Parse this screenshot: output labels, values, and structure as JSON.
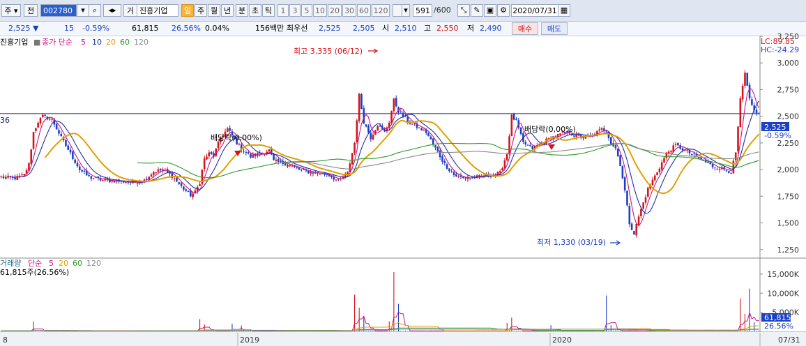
{
  "toolbar": {
    "market_select": "주",
    "prev_label": "전",
    "code": "002780",
    "name_prefix": "거",
    "stock_name": "진흥기업",
    "periods": [
      "일",
      "주",
      "월",
      "년",
      "분",
      "초",
      "틱"
    ],
    "active_period": "일",
    "intervals": [
      "1",
      "3",
      "5",
      "10",
      "20",
      "30",
      "60",
      "120"
    ],
    "count": "591",
    "count_total": "/600",
    "date": "2020/07/31"
  },
  "quote": {
    "price": "2,525",
    "change_arrow": "▼",
    "change": "15",
    "change_pct": "-0.59%",
    "volume": "61,815",
    "volume_ratio": "26.56%",
    "turnover": "0.04%",
    "amount": "156백만",
    "priority_label": "최우선",
    "ask": "2,525",
    "bid": "2,505",
    "open_label": "시",
    "open": "2,510",
    "high_label": "고",
    "high": "2,550",
    "low_label": "저",
    "low": "2,490",
    "buy_label": "매수",
    "sell_label": "매도"
  },
  "colors": {
    "up": "#d6131b",
    "down": "#1a3fc8",
    "ma5": "#c71585",
    "ma10": "#1f2e9e",
    "ma20": "#e0a000",
    "ma60": "#2a9a2a",
    "ma120": "#8a8a8a",
    "price_line": "#1a237e",
    "toolbar_bg": "#dfe6f1"
  },
  "chart_data": [
    {
      "type": "line",
      "title": "진흥기업",
      "legend": {
        "indicator": "종가 단순",
        "periods": [
          "5",
          "10",
          "20",
          "60",
          "120"
        ]
      },
      "partial_label_left": "36",
      "ylim": [
        1170,
        3250
      ],
      "yticks": [
        "3,250",
        "3,000",
        "2,750",
        "2,500",
        "2,250",
        "2,000",
        "1,750",
        "1,500",
        "1,250"
      ],
      "ytick_values": [
        3250,
        3000,
        2750,
        2500,
        2250,
        2000,
        1750,
        1500,
        1250
      ],
      "lc_label": "LC:89.85",
      "hc_label": "HC:-24.29",
      "current_price": 2525,
      "current_price_label": "2,525",
      "current_change_label": "-0.59%",
      "x_labels": [
        "8",
        "2019",
        "2020",
        "07/31"
      ],
      "annotations": {
        "high": "최고 3,335 (06/12)",
        "low": "최저 1,330 (03/19)",
        "div1": "배당락(0,00%)",
        "div2": "배당락(0,00%)"
      },
      "close_path": [
        [
          0,
          1930
        ],
        [
          6,
          1920
        ],
        [
          10,
          1950
        ],
        [
          12,
          2050
        ],
        [
          14,
          2350
        ],
        [
          16,
          2450
        ],
        [
          18,
          2500
        ],
        [
          22,
          2470
        ],
        [
          26,
          2300
        ],
        [
          30,
          2150
        ],
        [
          34,
          2000
        ],
        [
          38,
          1930
        ],
        [
          44,
          1900
        ],
        [
          52,
          1890
        ],
        [
          58,
          1880
        ],
        [
          62,
          1900
        ],
        [
          66,
          1980
        ],
        [
          70,
          2000
        ],
        [
          74,
          1940
        ],
        [
          78,
          1840
        ],
        [
          82,
          1760
        ],
        [
          84,
          1790
        ],
        [
          86,
          1880
        ],
        [
          88,
          2100
        ],
        [
          90,
          2150
        ],
        [
          92,
          2130
        ],
        [
          95,
          2300
        ],
        [
          98,
          2380
        ],
        [
          100,
          2320
        ],
        [
          102,
          2250
        ],
        [
          104,
          2200
        ],
        [
          108,
          2120
        ],
        [
          112,
          2150
        ],
        [
          116,
          2180
        ],
        [
          118,
          2080
        ],
        [
          124,
          2050
        ],
        [
          130,
          1990
        ],
        [
          136,
          1970
        ],
        [
          142,
          1950
        ],
        [
          146,
          1890
        ],
        [
          150,
          1970
        ],
        [
          153,
          2250
        ],
        [
          155,
          2700
        ],
        [
          157,
          2450
        ],
        [
          160,
          2300
        ],
        [
          163,
          2420
        ],
        [
          166,
          2350
        ],
        [
          168,
          2450
        ],
        [
          170,
          2650
        ],
        [
          172,
          2550
        ],
        [
          176,
          2450
        ],
        [
          180,
          2400
        ],
        [
          184,
          2350
        ],
        [
          188,
          2200
        ],
        [
          192,
          2050
        ],
        [
          196,
          1950
        ],
        [
          200,
          1920
        ],
        [
          206,
          1930
        ],
        [
          212,
          1950
        ],
        [
          216,
          1970
        ],
        [
          219,
          2150
        ],
        [
          221,
          2500
        ],
        [
          223,
          2450
        ],
        [
          226,
          2250
        ],
        [
          230,
          2200
        ],
        [
          234,
          2250
        ],
        [
          238,
          2300
        ],
        [
          242,
          2330
        ],
        [
          246,
          2350
        ],
        [
          248,
          2320
        ],
        [
          252,
          2300
        ],
        [
          256,
          2320
        ],
        [
          260,
          2380
        ],
        [
          262,
          2370
        ],
        [
          264,
          2250
        ],
        [
          266,
          2200
        ],
        [
          268,
          2050
        ],
        [
          270,
          1800
        ],
        [
          272,
          1500
        ],
        [
          274,
          1400
        ],
        [
          276,
          1560
        ],
        [
          280,
          1820
        ],
        [
          284,
          1980
        ],
        [
          288,
          2150
        ],
        [
          292,
          2230
        ],
        [
          296,
          2180
        ],
        [
          300,
          2130
        ],
        [
          304,
          2080
        ],
        [
          308,
          2030
        ],
        [
          312,
          2010
        ],
        [
          316,
          1980
        ],
        [
          318,
          2150
        ],
        [
          320,
          2650
        ],
        [
          322,
          2900
        ],
        [
          324,
          2650
        ],
        [
          326,
          2550
        ],
        [
          328,
          2525
        ]
      ],
      "n_days": 329,
      "ma_period_days": [
        5,
        10,
        20,
        60,
        120
      ],
      "ma20_shown_from_day": 6
    },
    {
      "type": "bar",
      "title": "거래량",
      "legend": {
        "indicator": "단순",
        "periods": [
          "5",
          "20",
          "60",
          "120"
        ]
      },
      "sub_label": "61,815주(26.56%)",
      "ylim": [
        0,
        19000
      ],
      "yticks": [
        "15,000K",
        "10,000K",
        "5,000K"
      ],
      "ytick_values": [
        15000,
        10000,
        5000
      ],
      "current_volume_label": "61,815",
      "current_ratio_label": "26.56%",
      "base_volume_k": 130,
      "spikes_k": [
        [
          14,
          2600
        ],
        [
          86,
          3200
        ],
        [
          88,
          1800
        ],
        [
          100,
          2000
        ],
        [
          104,
          1500
        ],
        [
          153,
          9600
        ],
        [
          155,
          6200
        ],
        [
          157,
          3800
        ],
        [
          168,
          2600
        ],
        [
          170,
          15500
        ],
        [
          172,
          7200
        ],
        [
          219,
          2200
        ],
        [
          221,
          3600
        ],
        [
          238,
          1600
        ],
        [
          262,
          9400
        ],
        [
          264,
          1600
        ],
        [
          320,
          8600
        ],
        [
          322,
          4600
        ],
        [
          324,
          11200
        ],
        [
          326,
          2400
        ]
      ]
    }
  ]
}
